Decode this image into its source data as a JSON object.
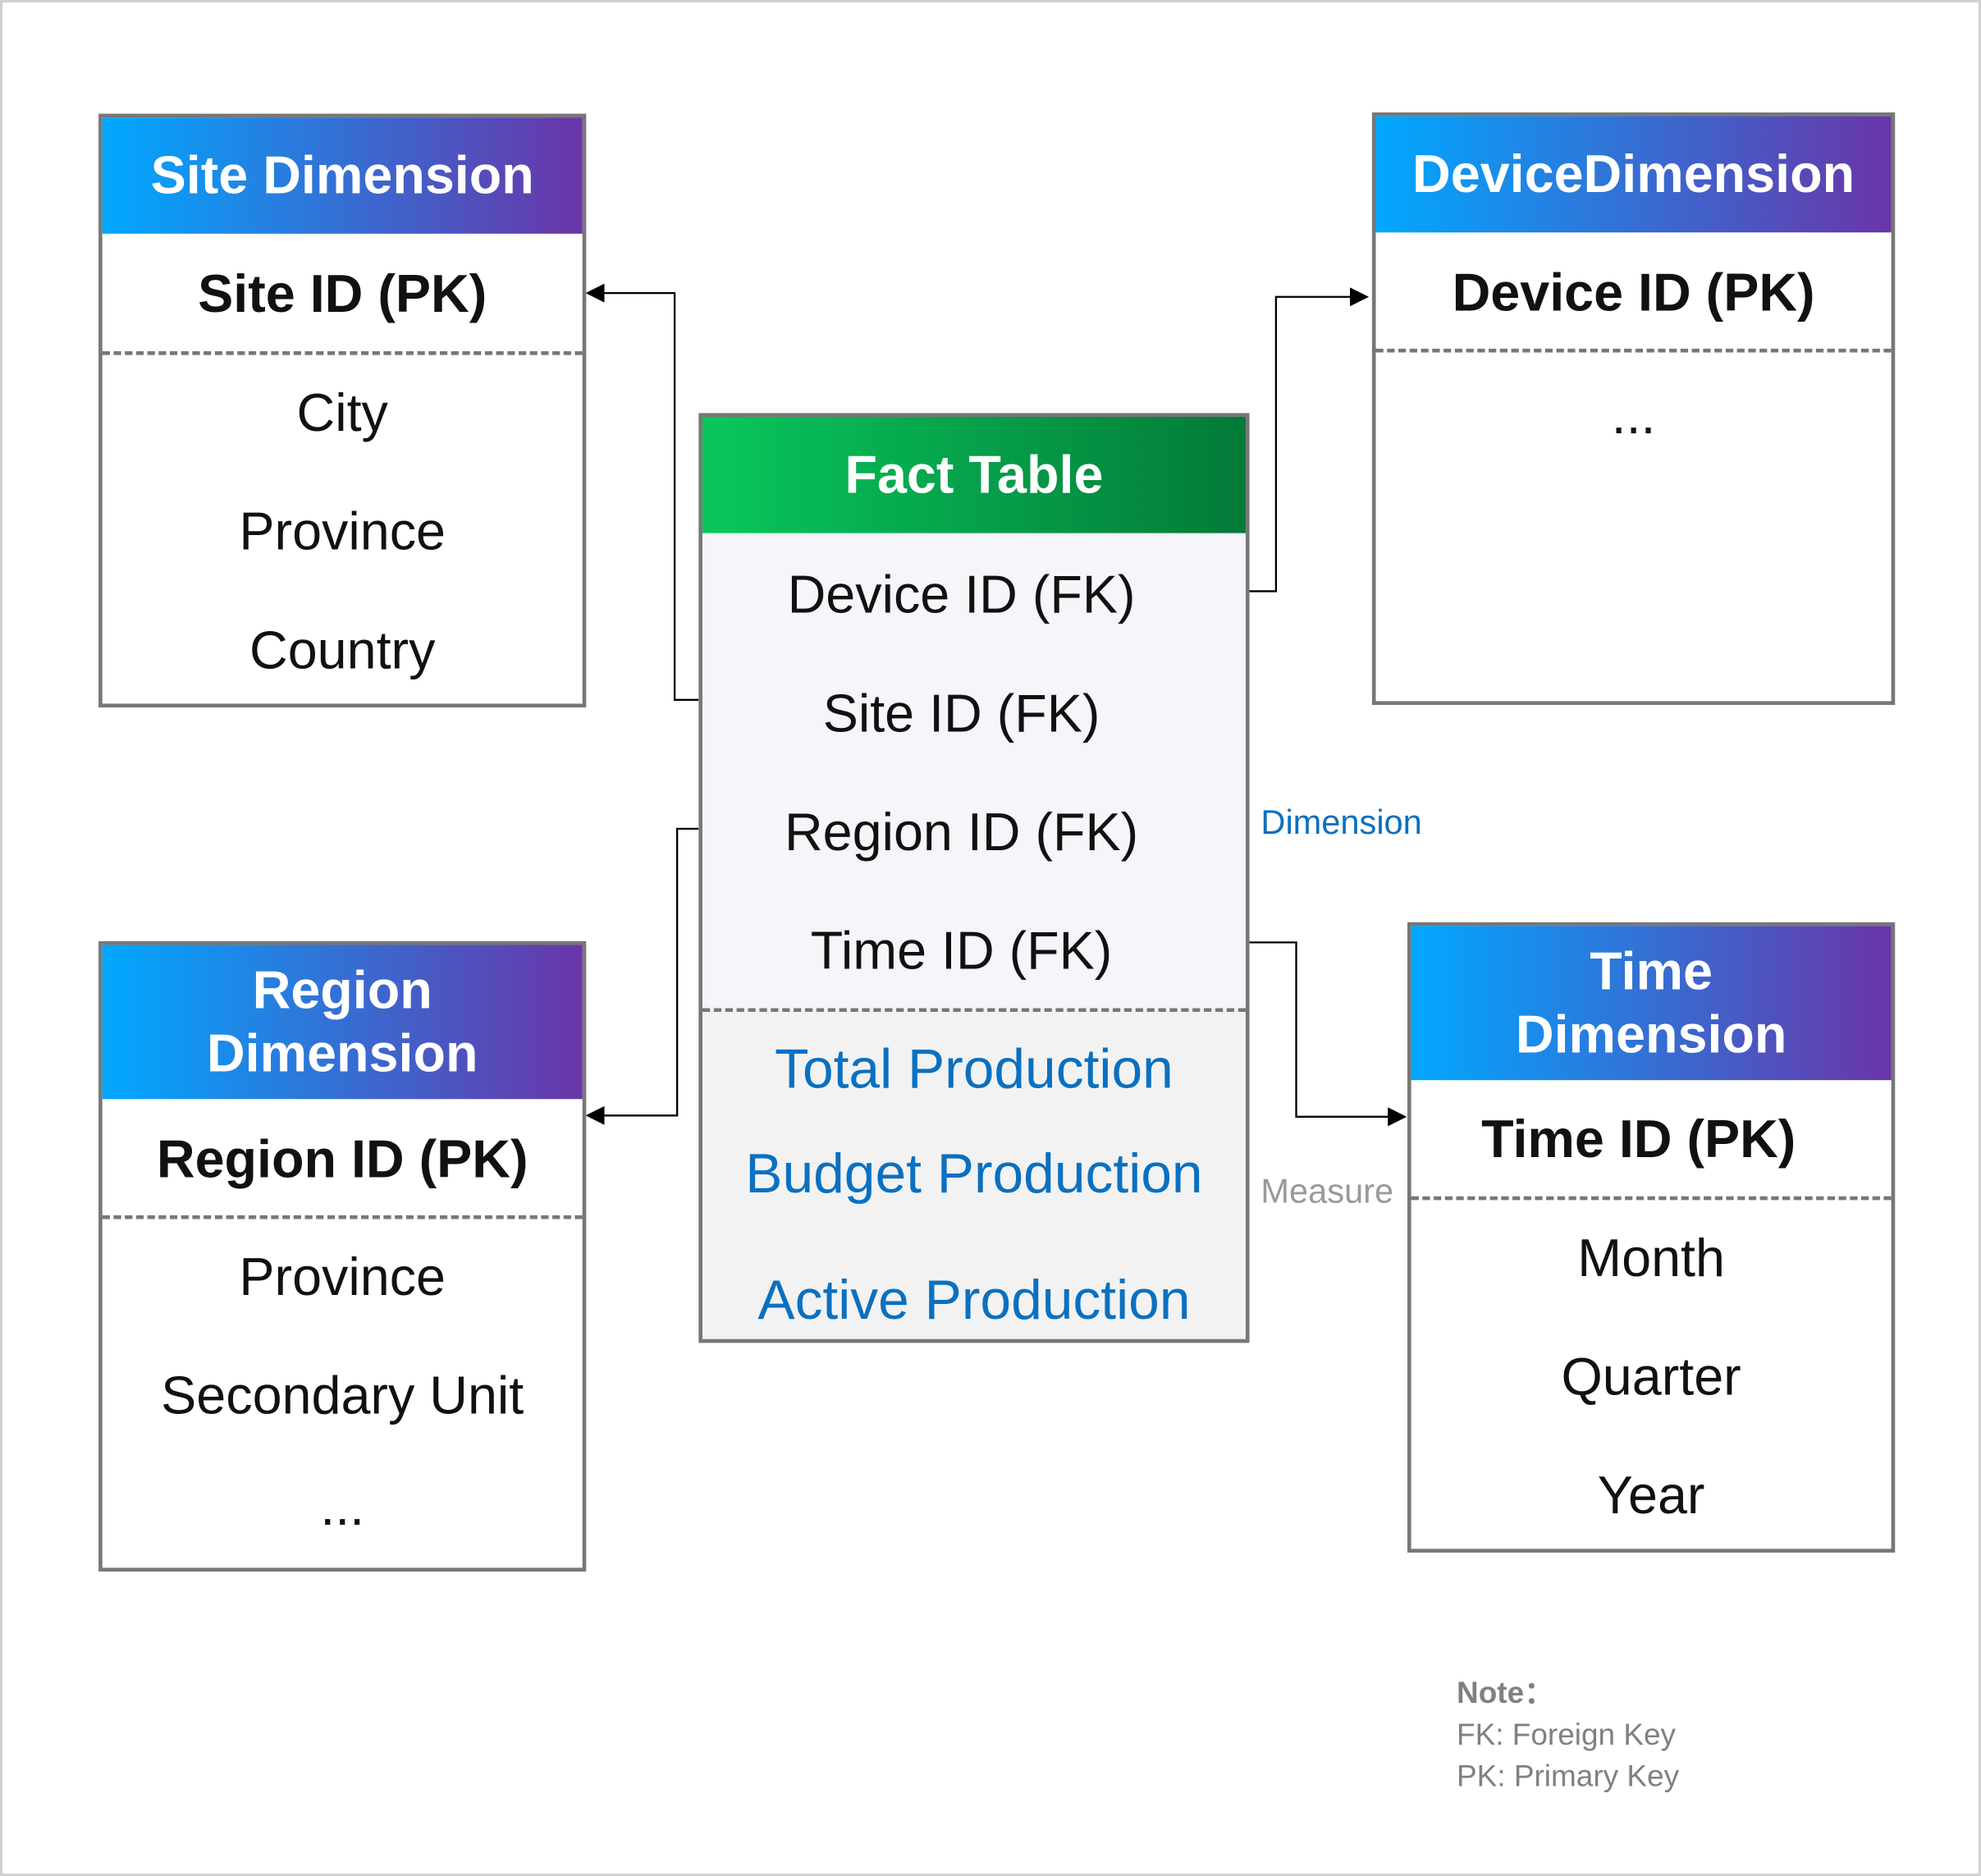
{
  "site_dimension": {
    "title": "Site Dimension",
    "pk": "Site ID  (PK)",
    "attributes": [
      "City",
      "Province",
      "Country"
    ]
  },
  "device_dimension": {
    "title": "DeviceDimension",
    "pk": "Device ID  (PK)",
    "attributes": [
      "..."
    ]
  },
  "region_dimension": {
    "title": "Region Dimension",
    "pk": "Region ID  (PK)",
    "attributes": [
      "Province",
      "Secondary Unit",
      "..."
    ]
  },
  "time_dimension": {
    "title": "Time Dimension",
    "pk": "Time ID  (PK)",
    "attributes": [
      "Month",
      "Quarter",
      "Year"
    ]
  },
  "fact_table": {
    "title": "Fact Table",
    "foreign_keys": [
      "Device ID  (FK)",
      "Site ID  (FK)",
      "Region ID  (FK)",
      "Time ID  (FK)"
    ],
    "measures": [
      "Total Production",
      "Budget Production",
      "Active Production"
    ]
  },
  "labels": {
    "dimension": "Dimension",
    "measure": "Measure"
  },
  "note": {
    "title": "Note：",
    "lines": [
      "FK: Foreign Key",
      "PK: Primary Key"
    ]
  },
  "colors": {
    "dimension_header_start": "#00a8ff",
    "dimension_header_end": "#6a35a8",
    "fact_header_start": "#08c75c",
    "fact_header_end": "#037a38",
    "measure_text": "#0a70c0"
  }
}
